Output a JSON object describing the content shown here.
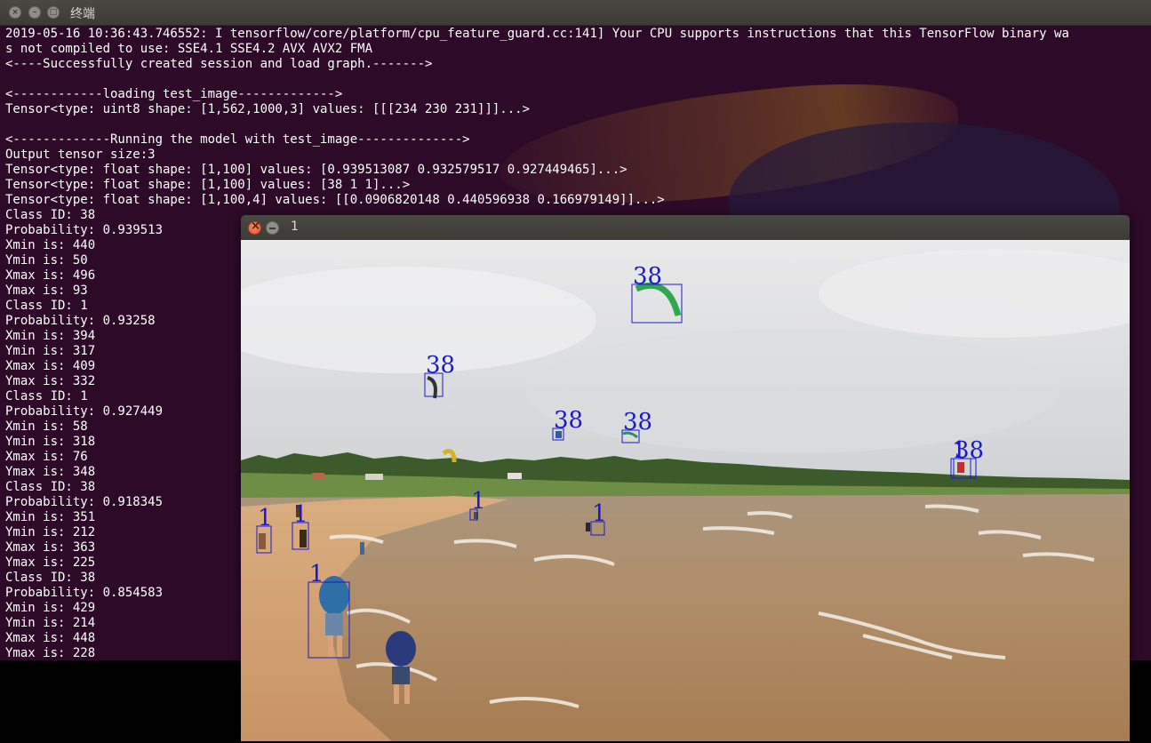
{
  "terminal": {
    "title": "终端",
    "lines": [
      "2019-05-16 10:36:43.746552: I tensorflow/core/platform/cpu_feature_guard.cc:141] Your CPU supports instructions that this TensorFlow binary wa",
      "s not compiled to use: SSE4.1 SSE4.2 AVX AVX2 FMA",
      "<----Successfully created session and load graph.------->",
      "",
      "<------------loading test_image------------->",
      "Tensor<type: uint8 shape: [1,562,1000,3] values: [[[234 230 231]]]...>",
      "",
      "<-------------Running the model with test_image-------------->",
      "Output tensor size:3",
      "Tensor<type: float shape: [1,100] values: [0.939513087 0.932579517 0.927449465]...>",
      "Tensor<type: float shape: [1,100] values: [38 1 1]...>",
      "Tensor<type: float shape: [1,100,4] values: [[0.0906820148 0.440596938 0.166979149]]...>",
      "Class ID: 38",
      "Probability: 0.939513",
      "Xmin is: 440",
      "Ymin is: 50",
      "Xmax is: 496",
      "Ymax is: 93",
      "Class ID: 1",
      "Probability: 0.93258",
      "Xmin is: 394",
      "Ymin is: 317",
      "Xmax is: 409",
      "Ymax is: 332",
      "Class ID: 1",
      "Probability: 0.927449",
      "Xmin is: 58",
      "Ymin is: 318",
      "Xmax is: 76",
      "Ymax is: 348",
      "Class ID: 38",
      "Probability: 0.918345",
      "Xmin is: 351",
      "Ymin is: 212",
      "Xmax is: 363",
      "Ymax is: 225",
      "Class ID: 38",
      "Probability: 0.854583",
      "Xmin is: 429",
      "Ymin is: 214",
      "Xmax is: 448",
      "Ymax is: 228"
    ]
  },
  "image_window": {
    "title": "1",
    "detections": [
      {
        "label": "38"
      },
      {
        "label": "38"
      },
      {
        "label": "38"
      },
      {
        "label": "38"
      },
      {
        "label": "38"
      },
      {
        "label": "1"
      },
      {
        "label": "1"
      },
      {
        "label": "1"
      },
      {
        "label": "1"
      },
      {
        "label": "1"
      },
      {
        "label": "1"
      }
    ],
    "box_color": "#1a1acc"
  },
  "colors": {
    "terminal_bg": "#2c0a28",
    "terminal_text": "#ffffff",
    "close_button": "#e2562b"
  }
}
